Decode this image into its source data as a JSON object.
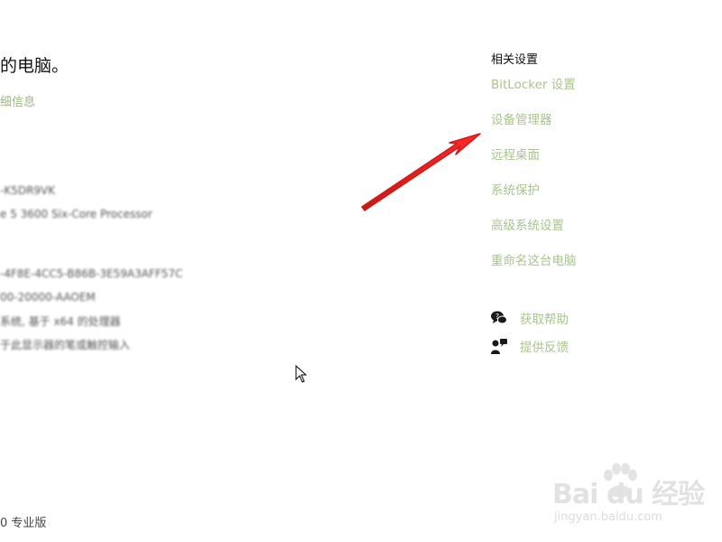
{
  "left": {
    "title_fragment": "的电脑。",
    "link_fragment": "细信息",
    "blurred": [
      "-K5DR9VK",
      "e 5 3600 Six-Core Processor",
      "-4F8E-4CC5-B86B-3E59A3AFF57C",
      "00-20000-AAOEM",
      "系统, 基于 x64 的处理器",
      "于此显示器的笔或触控输入"
    ],
    "edition": "0 专业版"
  },
  "related": {
    "heading": "相关设置",
    "links": [
      "BitLocker 设置",
      "设备管理器",
      "远程桌面",
      "系统保护",
      "高级系统设置",
      "重命名这台电脑"
    ]
  },
  "help": {
    "get_help": "获取帮助",
    "feedback": "提供反馈"
  },
  "watermark": {
    "logo": "Bai du 经验",
    "url": "jingyan.baidu.com"
  },
  "colors": {
    "link": "#a9c48c",
    "arrow": "#e02020",
    "heading": "#111111"
  }
}
